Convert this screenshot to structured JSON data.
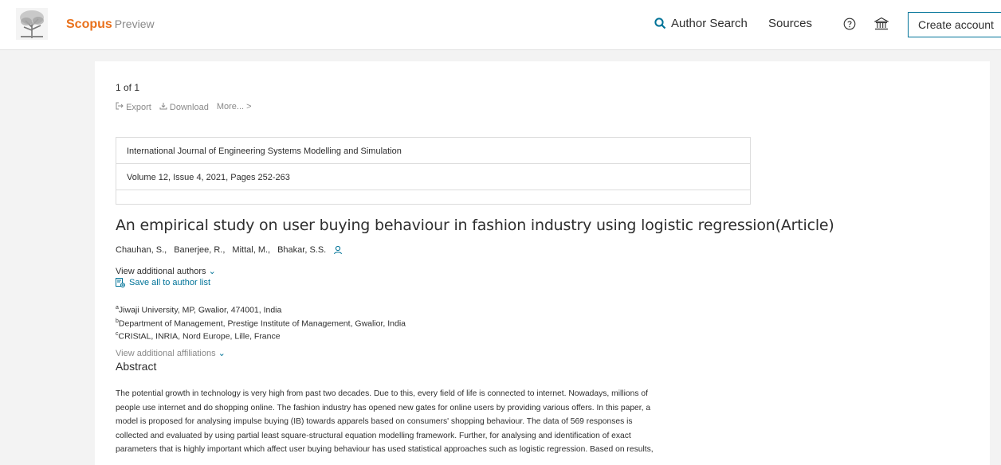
{
  "header": {
    "brand_name": "Scopus",
    "brand_sub": "Preview",
    "author_search": "Author Search",
    "sources": "Sources",
    "create_account": "Create account"
  },
  "result": {
    "count": "1 of 1",
    "export": "Export",
    "download": "Download",
    "more": "More... >"
  },
  "source": {
    "journal": "International Journal of Engineering Systems Modelling and Simulation",
    "details": "Volume 12, Issue 4, 2021, Pages 252-263"
  },
  "article": {
    "title": "An empirical study on user buying behaviour in fashion industry using logistic regression(Article)",
    "authors": [
      "Chauhan, S.,",
      "Banerjee, R.,",
      "Mittal, M.,",
      "Bhakar, S.S."
    ],
    "view_additional_authors": "View additional authors",
    "save_all": "Save all to author list",
    "affiliations": [
      {
        "sup": "a",
        "text": "Jiwaji University, MP, Gwalior, 474001, India"
      },
      {
        "sup": "b",
        "text": "Department of Management, Prestige Institute of Management, Gwalior, India"
      },
      {
        "sup": "c",
        "text": "CRIStAL, INRIA, Nord Europe, Lille, France"
      }
    ],
    "view_additional_affiliations": "View additional affiliations",
    "abstract_heading": "Abstract",
    "abstract_lines": [
      "The potential growth in technology is very high from past two decades. Due to this, every field of life is connected to internet. Nowadays, millions of",
      "people use internet and do shopping online. The fashion industry has opened new gates for online users by providing various offers. In this paper, a",
      "model is proposed for analysing impulse buying (IB) towards apparels based on consumers' shopping behaviour. The data of 569 responses is",
      "collected and evaluated by using partial least square-structural equation modelling framework. Further, for analysing and identification of exact",
      "parameters that is highly important which affect user buying behaviour has used statistical approaches such as logistic regression. Based on results,"
    ]
  },
  "colors": {
    "brand_orange": "#e9711c",
    "link_blue": "#007398",
    "background": "#f3f3f3"
  }
}
